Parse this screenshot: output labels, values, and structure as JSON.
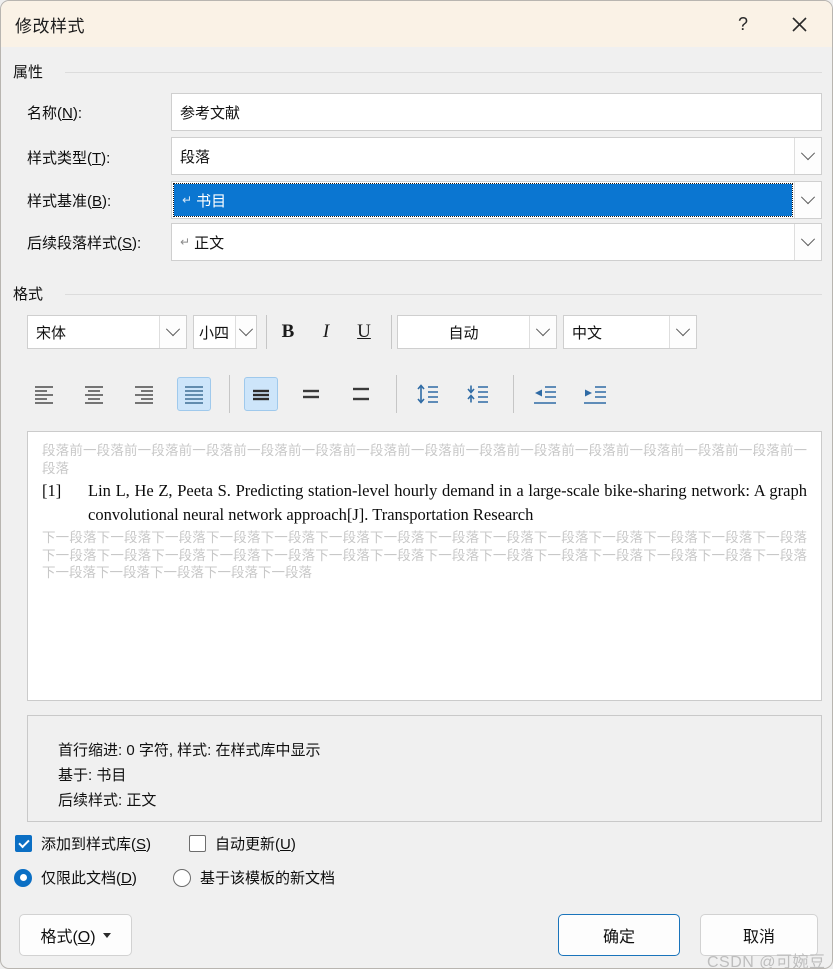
{
  "window": {
    "title": "修改样式",
    "help_icon": "?",
    "help_icon_name": "help-icon",
    "close_icon_name": "close-icon",
    "accent_blue": "#0b76d1",
    "titlebar_bg": "#faf2e6"
  },
  "properties": {
    "group_label": "属性",
    "fields": [
      {
        "label_pre": "名称(",
        "accel": "N",
        "label_post": "):",
        "value": "参考文献",
        "type": "text"
      },
      {
        "label_pre": "样式类型(",
        "accel": "T",
        "label_post": "):",
        "value": "段落",
        "type": "combo"
      },
      {
        "label_pre": "样式基准(",
        "accel": "B",
        "label_post": "):",
        "value": "书目",
        "prefix": "↵",
        "type": "combo",
        "selected": true
      },
      {
        "label_pre": "后续段落样式(",
        "accel": "S",
        "label_post": "):",
        "value": "正文",
        "prefix": "↵",
        "type": "combo"
      }
    ]
  },
  "format": {
    "group_label": "格式",
    "font_family": "宋体",
    "font_size": "小四",
    "bold_label": "B",
    "italic_label": "I",
    "underline_label": "U",
    "font_color": "自动",
    "language": "中文",
    "align_icons": [
      {
        "name": "align-left-icon",
        "on": false
      },
      {
        "name": "align-center-icon",
        "on": false
      },
      {
        "name": "align-right-icon",
        "on": false
      },
      {
        "name": "align-justify-icon",
        "on": true
      }
    ],
    "linespacing_icons": [
      {
        "name": "line-spacing-single-icon",
        "on": true
      },
      {
        "name": "line-spacing-1-5-icon",
        "on": false
      },
      {
        "name": "line-spacing-double-icon",
        "on": false
      }
    ],
    "paragraph_space_icons": [
      {
        "name": "increase-paragraph-spacing-icon",
        "on": false
      },
      {
        "name": "decrease-paragraph-spacing-icon",
        "on": false
      }
    ],
    "indent_icons": [
      {
        "name": "decrease-indent-icon",
        "on": false
      },
      {
        "name": "increase-indent-icon",
        "on": false
      }
    ]
  },
  "preview": {
    "ghost_before": "段落前一段落前一段落前一段落前一段落前一段落前一段落前一段落前一段落前一段落前一段落前一段落前一段落前一段落前一段落",
    "sample_marker": "[1]",
    "sample_text": "Lin L, He Z, Peeta S. Predicting station-level hourly demand in a large-scale bike-sharing network: A graph convolutional neural network approach[J]. Transportation Research",
    "ghost_after": "下一段落下一段落下一段落下一段落下一段落下一段落下一段落下一段落下一段落下一段落下一段落下一段落下一段落下一段落下一段落下一段落下一段落下一段落下一段落下一段落下一段落下一段落下一段落下一段落下一段落下一段落下一段落下一段落下一段落下一段落下一段落下一段落下一段落"
  },
  "description": {
    "line1": "首行缩进: 0 字符, 样式: 在样式库中显示",
    "line2": "基于: 书目",
    "line3": "后续样式: 正文"
  },
  "options": {
    "add_to_gallery": {
      "label_pre": "添加到样式库(",
      "accel": "S",
      "label_post": ")",
      "checked": true
    },
    "auto_update": {
      "label_pre": "自动更新(",
      "accel": "U",
      "label_post": ")",
      "checked": false
    },
    "only_this_doc": {
      "label_pre": "仅限此文档(",
      "accel": "D",
      "label_post": ")",
      "selected": true
    },
    "new_docs_from_template": {
      "label_pre": "基于该模板的新文档",
      "accel": "",
      "label_post": "",
      "selected": false
    }
  },
  "footer": {
    "format_button": {
      "label_pre": "格式(",
      "accel": "O",
      "label_post": ")"
    },
    "ok_button": "确定",
    "cancel_button": "取消"
  },
  "watermark": "CSDN @可婉豆"
}
